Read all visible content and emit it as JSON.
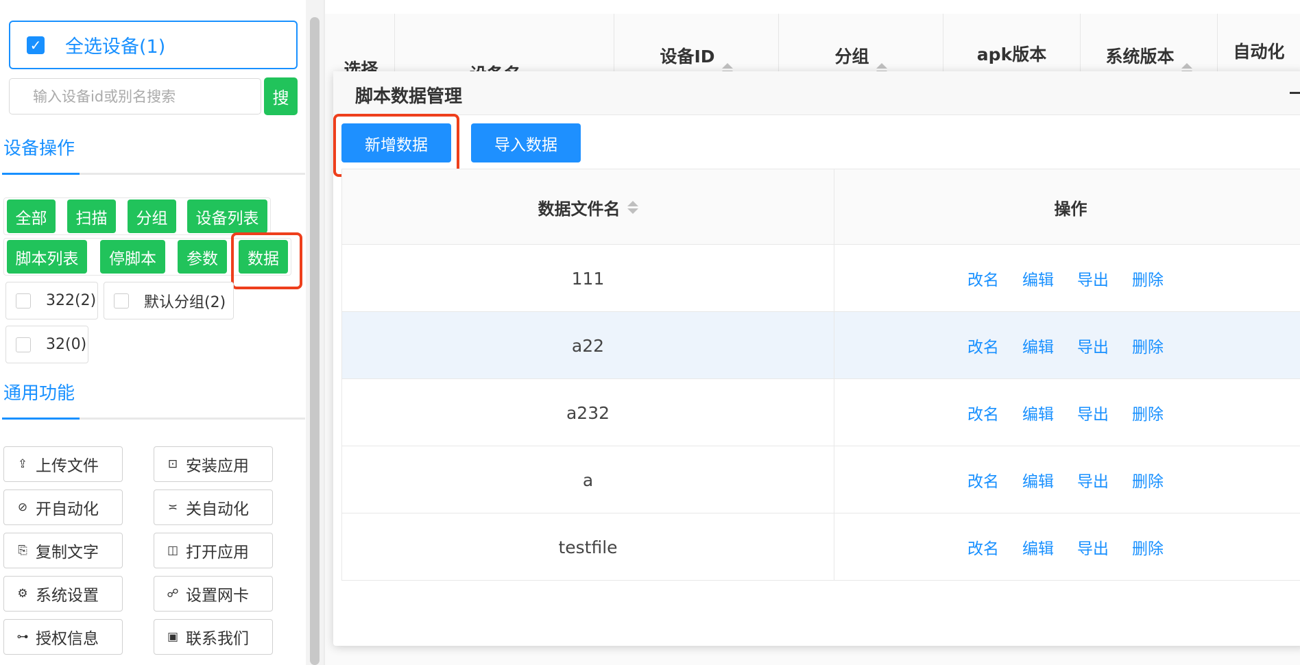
{
  "sidebar": {
    "select_all_label": "全选设备(1)",
    "search_placeholder": "输入设备id或别名搜索",
    "search_button": "搜",
    "device_ops_title": "设备操作",
    "group_buttons": [
      "全部",
      "扫描",
      "分组",
      "设备列表",
      "脚本列表",
      "停脚本",
      "参数",
      "数据"
    ],
    "groups": [
      "322(2)",
      "默认分组(2)",
      "32(0)"
    ],
    "common_title": "通用功能",
    "functions": [
      {
        "label": "上传文件",
        "icon": "upload-icon"
      },
      {
        "label": "安装应用",
        "icon": "install-icon"
      },
      {
        "label": "开自动化",
        "icon": "auto-on-icon"
      },
      {
        "label": "关自动化",
        "icon": "auto-off-icon"
      },
      {
        "label": "复制文字",
        "icon": "copy-icon"
      },
      {
        "label": "打开应用",
        "icon": "book-icon"
      },
      {
        "label": "系统设置",
        "icon": "gear-icon"
      },
      {
        "label": "设置网卡",
        "icon": "network-icon"
      },
      {
        "label": "授权信息",
        "icon": "key-icon"
      },
      {
        "label": "联系我们",
        "icon": "contact-icon"
      }
    ]
  },
  "bg_table": {
    "columns": [
      "选择",
      "设备名",
      "设备ID",
      "分组",
      "apk版本",
      "系统版本",
      "自动化"
    ]
  },
  "modal": {
    "title": "脚本数据管理",
    "add_button": "新增数据",
    "import_button": "导入数据",
    "col_name": "数据文件名",
    "col_ops": "操作",
    "ops": [
      "改名",
      "编辑",
      "导出",
      "删除"
    ],
    "rows": [
      "111",
      "a22",
      "a232",
      "a",
      "testfile"
    ]
  },
  "colors": {
    "accent_blue": "#1890ff",
    "green": "#21c35b",
    "highlight_red": "#ee3f1c"
  }
}
